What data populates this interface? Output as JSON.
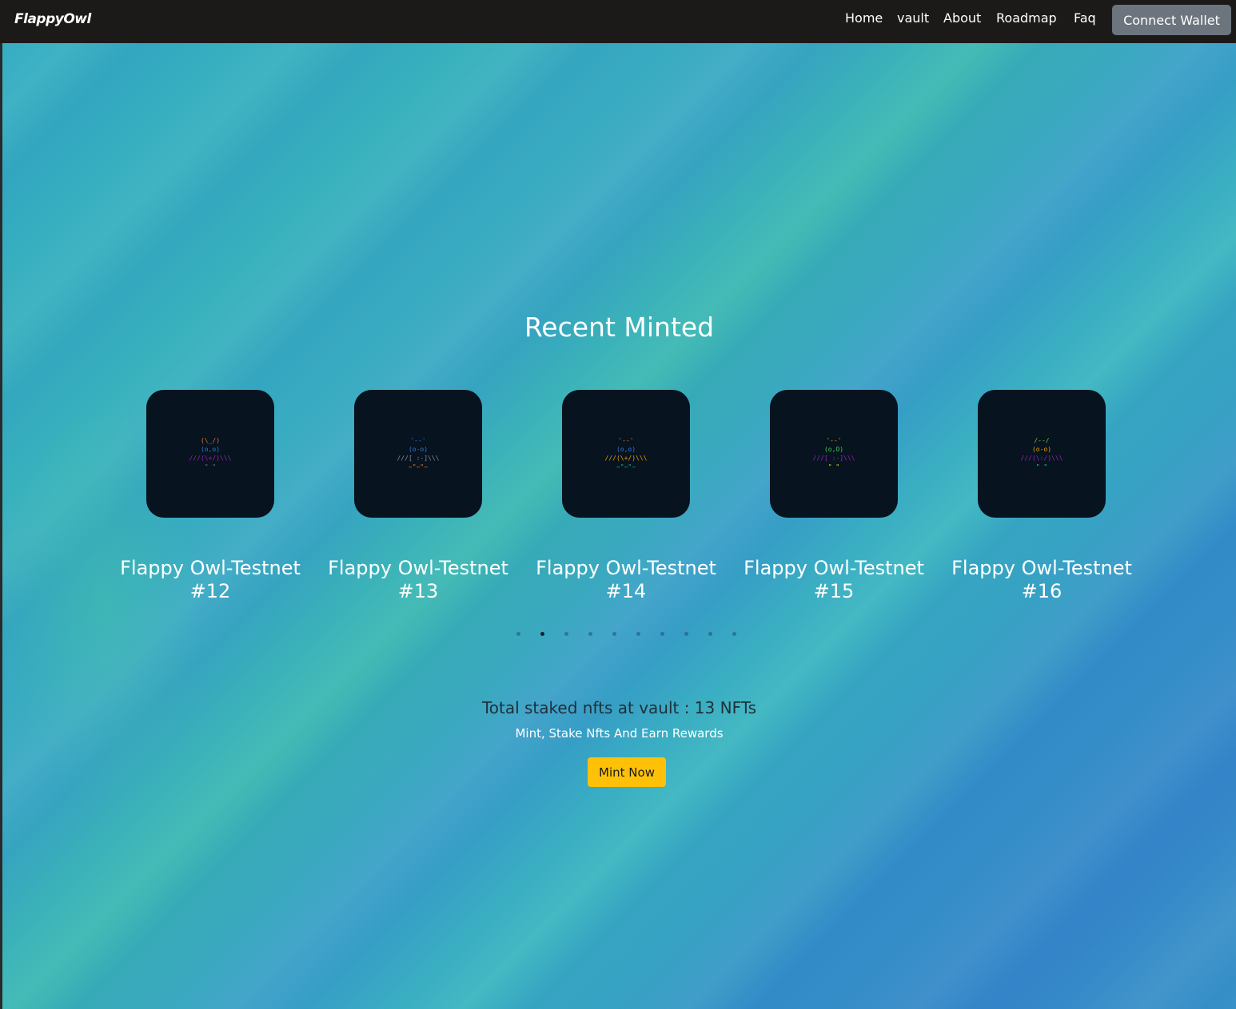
{
  "navbar": {
    "brand": "FlappyOwl",
    "links": [
      {
        "label": "Home"
      },
      {
        "label": "vault"
      },
      {
        "label": "About"
      },
      {
        "label": "Roadmap"
      },
      {
        "label": "Faq"
      }
    ],
    "connect_label": "Connect Wallet",
    "connect_color": "#6c757d"
  },
  "main": {
    "section_title": "Recent Minted",
    "cards": [
      {
        "title": "Flappy Owl-Testnet #12",
        "art": [
          {
            "text": "(\\_/)",
            "color": "#e8763a"
          },
          {
            "text": "(o,o)",
            "color": "#2f7fe0"
          },
          {
            "text": "///(\\+/)\\\\\\",
            "color": "#a020c0"
          },
          {
            "text": "\" \"",
            "color": "#6b7280"
          }
        ]
      },
      {
        "title": "Flappy Owl-Testnet #13",
        "art": [
          {
            "text": "'--'",
            "color": "#2f7fe0"
          },
          {
            "text": "(o-o)",
            "color": "#2f7fe0"
          },
          {
            "text": "///[ :-]\\\\\\",
            "color": "#8a8f98"
          },
          {
            "text": "~\"~\"~",
            "color": "#e8763a"
          }
        ]
      },
      {
        "title": "Flappy Owl-Testnet #14",
        "art": [
          {
            "text": "'--'",
            "color": "#e8763a"
          },
          {
            "text": "(o,o)",
            "color": "#2f7fe0"
          },
          {
            "text": "///(\\+/)\\\\\\",
            "color": "#f0a000"
          },
          {
            "text": "~\"~\"~",
            "color": "#20b0a0"
          }
        ]
      },
      {
        "title": "Flappy Owl-Testnet #15",
        "art": [
          {
            "text": "'--'",
            "color": "#f0a000"
          },
          {
            "text": "(o,O)",
            "color": "#40d060"
          },
          {
            "text": "///[ :-]\\\\\\",
            "color": "#a020c0"
          },
          {
            "text": "\" \"",
            "color": "#e0d020"
          }
        ]
      },
      {
        "title": "Flappy Owl-Testnet #16",
        "art": [
          {
            "text": "/--/",
            "color": "#70d040"
          },
          {
            "text": "(o-o)",
            "color": "#f0a000"
          },
          {
            "text": "///(\\:/)\\\\\\",
            "color": "#a020c0"
          },
          {
            "text": "\" \"",
            "color": "#20c0d0"
          }
        ]
      }
    ],
    "pagination": {
      "count": 10,
      "active_index": 1
    },
    "staked_text": "Total staked nfts at vault : 13 NFTs",
    "tagline": "Mint, Stake Nfts And Earn Rewards",
    "mint_label": "Mint Now",
    "mint_color": "#ffc107"
  }
}
